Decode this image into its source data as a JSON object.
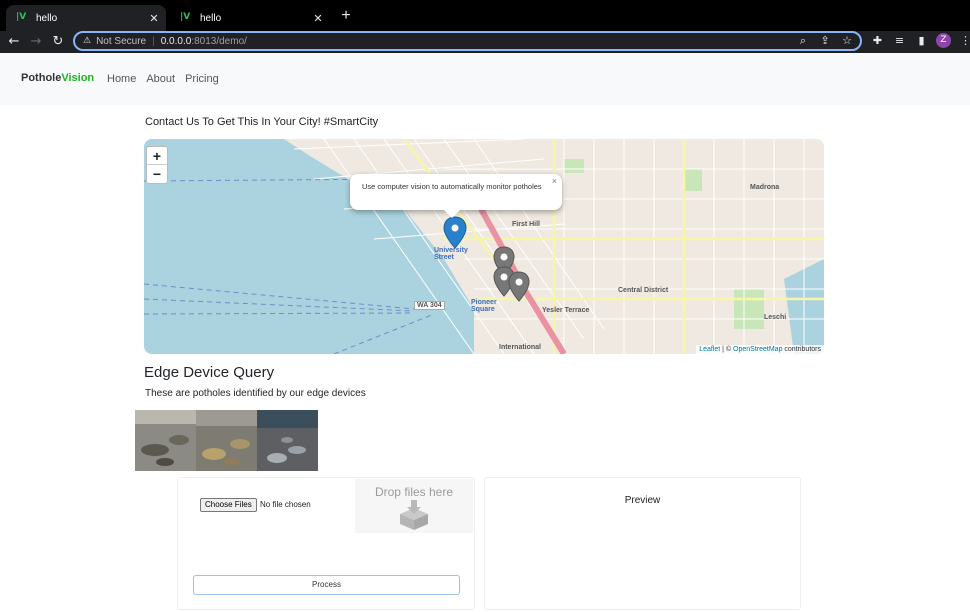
{
  "browser": {
    "tabs": [
      {
        "title": "hello",
        "favicon": "V",
        "active": true
      },
      {
        "title": "hello",
        "favicon": "V",
        "active": false
      }
    ],
    "address": {
      "security_label": "Not Secure",
      "host": "0.0.0.0",
      "path": ":8013/demo/"
    },
    "profile_initial": "Z"
  },
  "site": {
    "brand_prefix": "Pothole",
    "brand_suffix": "Vision",
    "brand_color": "#1fb31f",
    "nav": [
      "Home",
      "About",
      "Pricing"
    ],
    "tagline": "Contact Us To Get This In Your City! #SmartCity"
  },
  "map": {
    "zoom_in": "+",
    "zoom_out": "−",
    "popup_text": "Use computer vision to automatically monitor potholes",
    "popup_close": "×",
    "attribution_leaflet": "Leaflet",
    "attribution_sep": " | © ",
    "attribution_osm": "OpenStreetMap",
    "attribution_suffix": " contributors",
    "labels": {
      "first_hill": "First Hill",
      "madrona": "Madrona",
      "central_district": "Central District",
      "yesler_terrace": "Yesler Terrace",
      "pioneer_square": "Pioneer\nSquare",
      "university_street": "University\nStreet",
      "international": "International",
      "leschi": "Leschi",
      "wa304": "WA 304"
    }
  },
  "query": {
    "title": "Edge Device Query",
    "subtitle": "These are potholes identified by our edge devices"
  },
  "upload": {
    "choose_label": "Choose Files",
    "no_file": "No file chosen",
    "drop_text": "Drop files here",
    "process_label": "Process"
  },
  "preview": {
    "title": "Preview"
  }
}
